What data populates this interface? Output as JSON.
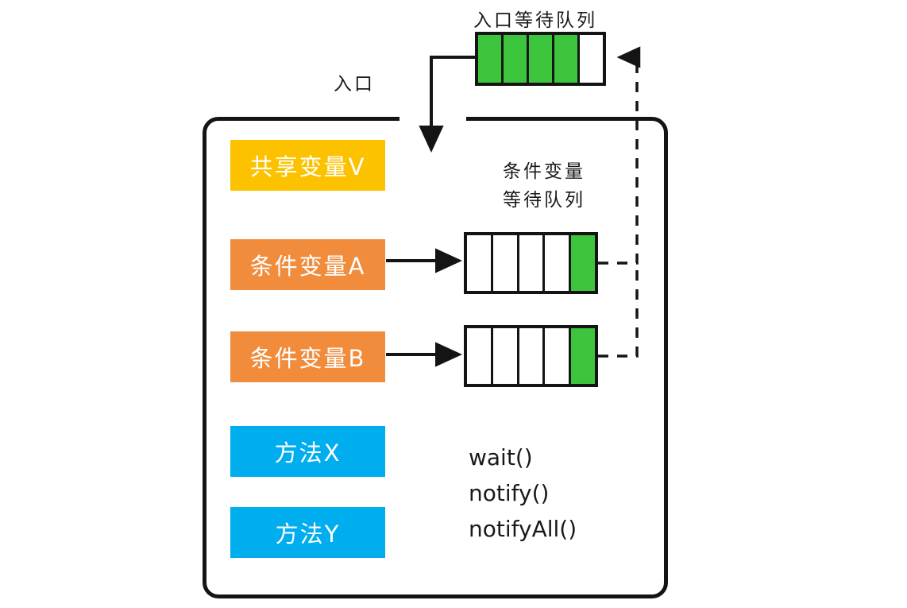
{
  "diagram": {
    "title_labels": {
      "entry_queue_caption": "入口等待队列",
      "entry_label": "入口",
      "cond_queue_caption_line1": "条件变量",
      "cond_queue_caption_line2": "等待队列"
    },
    "members": [
      {
        "name": "shared-variable",
        "label": "共享变量V",
        "color": "#fcc200"
      },
      {
        "name": "condition-variable-a",
        "label": "条件变量A",
        "color": "#f08c3c"
      },
      {
        "name": "condition-variable-b",
        "label": "条件变量B",
        "color": "#f08c3c"
      },
      {
        "name": "method-x",
        "label": "方法X",
        "color": "#00adef"
      },
      {
        "name": "method-y",
        "label": "方法Y",
        "color": "#00adef"
      }
    ],
    "queues": [
      {
        "name": "entry-wait-queue",
        "cells": [
          "filled",
          "filled",
          "filled",
          "filled",
          "empty"
        ],
        "filled_count": 4,
        "capacity": 5
      },
      {
        "name": "condition-a-wait-queue",
        "cells": [
          "empty",
          "empty",
          "empty",
          "empty",
          "filled"
        ],
        "filled_count": 1,
        "capacity": 5
      },
      {
        "name": "condition-b-wait-queue",
        "cells": [
          "empty",
          "empty",
          "empty",
          "empty",
          "filled"
        ],
        "filled_count": 1,
        "capacity": 5
      }
    ],
    "methods": {
      "lines": [
        "wait()",
        "notify()",
        "notifyAll()"
      ]
    },
    "colors": {
      "green_filled": "#3cc53c",
      "yellow": "#fcc200",
      "orange": "#f08c3c",
      "blue": "#00adef",
      "stroke": "#141414",
      "background": "#ffffff"
    }
  }
}
